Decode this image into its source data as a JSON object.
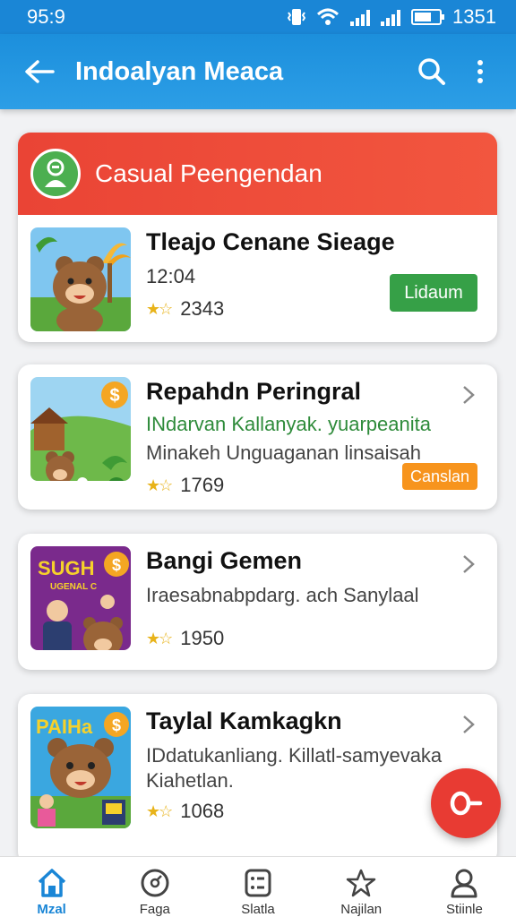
{
  "status_bar": {
    "time": "95:9",
    "clock_right": "1351"
  },
  "app_bar": {
    "title": "Indoalyan Meaca"
  },
  "featured": {
    "header_title": "Casual Peengendan",
    "game": {
      "title": "Tleajo Cenane Sieage",
      "time": "12:04",
      "rating_count": "2343",
      "action_label": "Lidaum"
    }
  },
  "games": [
    {
      "title": "Repahdn Peringral",
      "subtitle_green": "INdarvan Kallanyak. yuarpeanita",
      "subtitle_gray": "Minakeh Unguaganan linsaisah",
      "rating_count": "1769",
      "action_label": "Canslan"
    },
    {
      "title": "Bangi Gemen",
      "subtitle_gray": "Iraesabnabpdarg. ach Sanylaal",
      "rating_count": "1950",
      "thumb_text": "SUGH",
      "thumb_subtext": "UGENAL C"
    },
    {
      "title": "Taylal Kamkagkn",
      "subtitle_gray": "IDdatukanliang. Killatl-samyevaka",
      "subtitle_gray2": "Kiahetlan.",
      "rating_count": "1068",
      "thumb_text": "PAIHa"
    }
  ],
  "bottom_nav": [
    {
      "label": "Mzal",
      "icon": "home-icon",
      "active": true
    },
    {
      "label": "Faga",
      "icon": "disc-icon",
      "active": false
    },
    {
      "label": "Slatla",
      "icon": "list-icon",
      "active": false
    },
    {
      "label": "Najilan",
      "icon": "star-icon",
      "active": false
    },
    {
      "label": "Stiinle",
      "icon": "user-icon",
      "active": false
    }
  ],
  "colors": {
    "primary": "#1a86d6",
    "header_red": "#ea4435",
    "download_green": "#36a047",
    "cancel_orange": "#f7941d",
    "fab_red": "#e83b33"
  }
}
